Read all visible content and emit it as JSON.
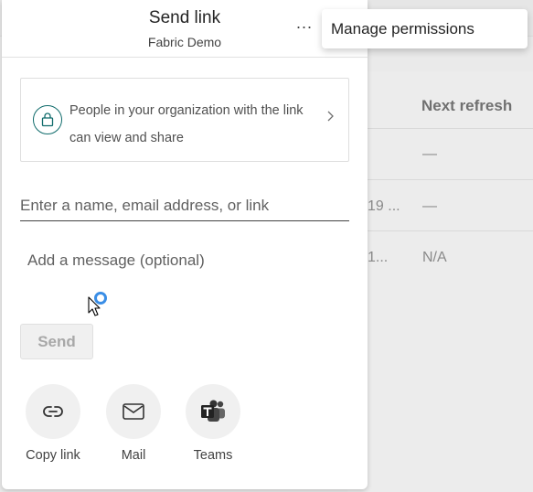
{
  "background": {
    "table_header": "Next refresh",
    "rows": [
      {
        "left": "",
        "right": "—"
      },
      {
        "left": "19 ...",
        "right": "—"
      },
      {
        "left": "1...",
        "right": "N/A"
      }
    ]
  },
  "dialog": {
    "title": "Send link",
    "subtitle": "Fabric Demo",
    "more_label": "...",
    "link_settings": {
      "icon": "lock-icon",
      "description": "People in your organization with the link can view and share"
    },
    "recipient_placeholder": "Enter a name, email address, or link",
    "message_placeholder": "Add a message (optional)",
    "send_label": "Send",
    "share_options": [
      {
        "label": "Copy link",
        "icon": "link-icon"
      },
      {
        "label": "Mail",
        "icon": "mail-icon"
      },
      {
        "label": "Teams",
        "icon": "teams-icon"
      }
    ]
  },
  "popup_menu": {
    "items": [
      {
        "label": "Manage permissions"
      }
    ]
  },
  "colors": {
    "teal_accent": "#0f6b6b",
    "busy_cursor_ring": "#3a8ee6"
  }
}
